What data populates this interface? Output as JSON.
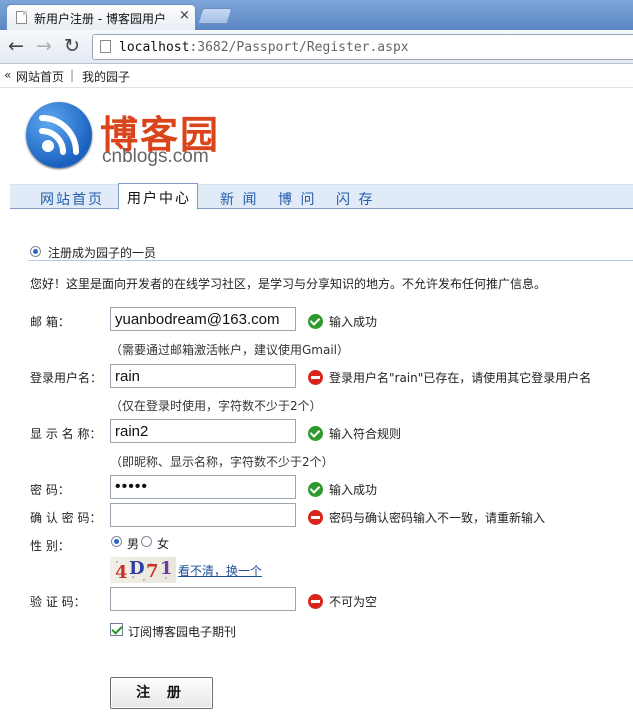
{
  "browser": {
    "tab_title": "新用户注册 - 博客园用户",
    "tab_close": "×",
    "address_host": "localhost",
    "address_path": ":3682/Passport/Register.aspx"
  },
  "topbar": {
    "arrow": "«",
    "home": "网站首页",
    "separator": "|",
    "garden": "我的园子"
  },
  "logo": {
    "cn": "博客园",
    "en": "cnblogs.com"
  },
  "nav": {
    "items": [
      "网站首页",
      "用户中心",
      "新 闻",
      "博 问",
      "闪 存"
    ],
    "active_index": 1
  },
  "section": {
    "title": "注册成为园子的一员",
    "intro": "您好！这里是面向开发者的在线学习社区，是学习与分享知识的地方。不允许发布任何推广信息。"
  },
  "form": {
    "email": {
      "label": "邮 箱：",
      "value": "yuanbodream@163.com",
      "status": "输入成功",
      "status_type": "ok",
      "hint": "（需要通过邮箱激活帐户，建议使用Gmail）"
    },
    "username": {
      "label": "登录用户名：",
      "value": "rain",
      "status": "登录用户名\"rain\"已存在，请使用其它登录用户名",
      "status_type": "error",
      "hint": "（仅在登录时使用，字符数不少于2个）"
    },
    "display_name": {
      "label": "显 示 名 称：",
      "value": "rain2",
      "status": "输入符合规则",
      "status_type": "ok",
      "hint": "（即昵称、显示名称，字符数不少于2个）"
    },
    "password": {
      "label": "密 码：",
      "value": "•••••",
      "status": "输入成功",
      "status_type": "ok"
    },
    "confirm_password": {
      "label": "确 认 密 码：",
      "value": "",
      "status": "密码与确认密码输入不一致，请重新输入",
      "status_type": "error"
    },
    "gender": {
      "label": "性 别：",
      "options": [
        "男",
        "女"
      ],
      "selected": "男"
    },
    "captcha": {
      "chars": [
        "4",
        "D",
        "7",
        "1"
      ],
      "colors": [
        "#c8322a",
        "#2c3fa6",
        "#c8322a",
        "#6a3aa6"
      ],
      "refresh_link": "看不清，换一个"
    },
    "verification": {
      "label": "验 证 码：",
      "value": "",
      "status": "不可为空",
      "status_type": "error"
    },
    "subscribe": {
      "label": "订阅博客园电子期刊",
      "checked": true
    },
    "submit_label": "注 册"
  },
  "colors": {
    "brand_red": "#d9441a",
    "nav_bg": "#e1ebf7",
    "link_blue": "#1d4f9a",
    "ok_green": "#2f9a2c",
    "error_red": "#d8261e"
  }
}
